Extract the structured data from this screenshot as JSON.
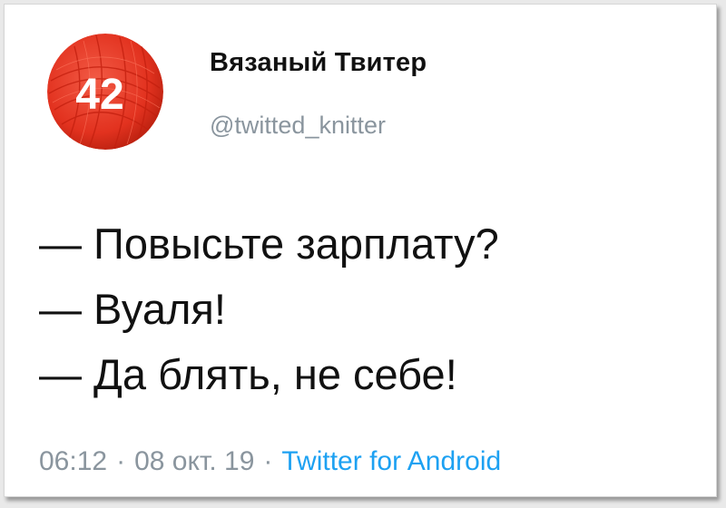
{
  "profile": {
    "display_name": "Вязаный Твитер",
    "handle": "@twitted_knitter",
    "avatar_label": "42"
  },
  "tweet": {
    "lines": [
      "— Повысьте зарплату?",
      "— Вуаля!",
      "— Да блять, не себе!"
    ]
  },
  "meta": {
    "time": "06:12",
    "date": "08 окт. 19",
    "separator": "·",
    "source": "Twitter for Android"
  },
  "colors": {
    "avatar_red": "#e8342a",
    "meta_gray": "#8a959e",
    "link_blue": "#1da1f2"
  }
}
